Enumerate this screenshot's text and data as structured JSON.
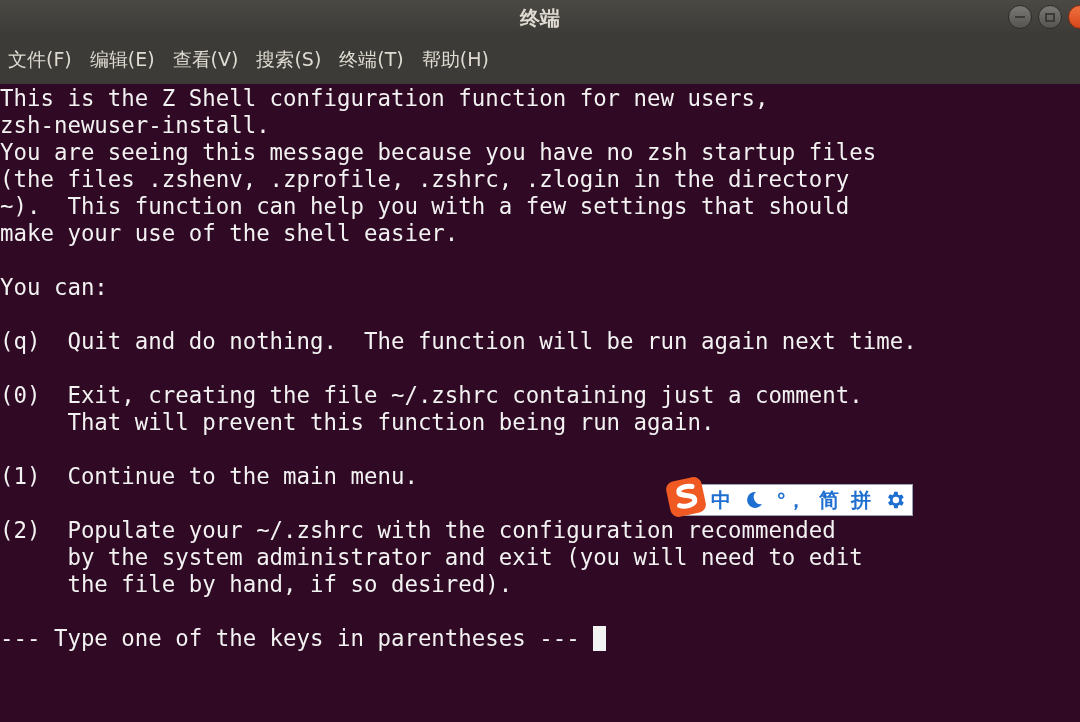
{
  "window": {
    "title": "终端"
  },
  "menu": [
    "文件(F)",
    "编辑(E)",
    "查看(V)",
    "搜索(S)",
    "终端(T)",
    "帮助(H)"
  ],
  "terminal": {
    "paragraphs": [
      [
        "This is the Z Shell configuration function for new users,",
        "zsh-newuser-install.",
        "You are seeing this message because you have no zsh startup files",
        "(the files .zshenv, .zprofile, .zshrc, .zlogin in the directory",
        "~).  This function can help you with a few settings that should",
        "make your use of the shell easier."
      ],
      [
        "You can:"
      ],
      [
        "(q)  Quit and do nothing.  The function will be run again next time."
      ],
      [
        "(0)  Exit, creating the file ~/.zshrc containing just a comment.",
        "     That will prevent this function being run again."
      ],
      [
        "(1)  Continue to the main menu."
      ],
      [
        "(2)  Populate your ~/.zshrc with the configuration recommended",
        "     by the system administrator and exit (you will need to edit",
        "     the file by hand, if so desired)."
      ],
      [
        "--- Type one of the keys in parentheses --- "
      ]
    ]
  },
  "ime_bar": {
    "mode": "中",
    "punctuation": "°，",
    "script": "简",
    "input": "拼"
  }
}
